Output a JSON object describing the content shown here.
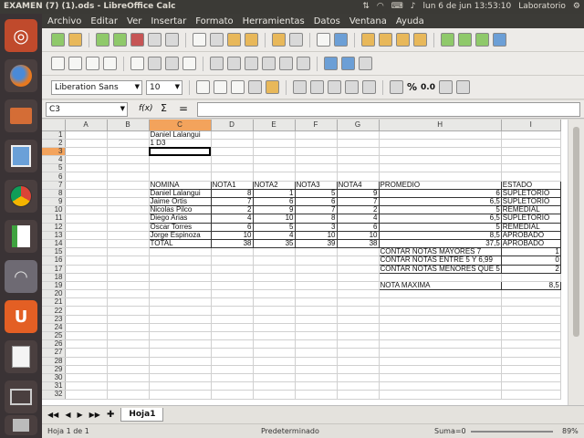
{
  "window": {
    "title": "EXAMEN (7) (1).ods - LibreOffice Calc"
  },
  "system": {
    "datetime": "lun 6 de jun 13:53:10",
    "user": "Laboratorio"
  },
  "menu": [
    "Archivo",
    "Editar",
    "Ver",
    "Insertar",
    "Formato",
    "Herramientas",
    "Datos",
    "Ventana",
    "Ayuda"
  ],
  "toolbar": {
    "font_name": "Liberation Sans",
    "font_size": "10",
    "percent": "%",
    "decimal": "0.0"
  },
  "formula": {
    "cell_ref": "C3",
    "fx": "f(x)",
    "sum": "Σ",
    "equals": "=",
    "value": ""
  },
  "columns": [
    "A",
    "B",
    "C",
    "D",
    "E",
    "F",
    "G",
    "H",
    "I"
  ],
  "selected_column": "C",
  "selected_row": 3,
  "rows": [
    {
      "n": "1",
      "c": "Daniel Lalangui"
    },
    {
      "n": "2",
      "c": "1 D3"
    },
    {
      "n": "3"
    },
    {
      "n": "4"
    },
    {
      "n": "5"
    },
    {
      "n": "6"
    },
    {
      "n": "7",
      "c": "NOMINA",
      "d": "NOTA1",
      "e": "NOTA2",
      "f": "NOTA3",
      "g": "NOTA4",
      "h": "PROMEDIO",
      "i": "ESTADO"
    },
    {
      "n": "8",
      "c": "Daniel Lalangui",
      "d": "8",
      "e": "1",
      "f": "5",
      "g": "9",
      "h": "6",
      "i": "SUPLETORIO"
    },
    {
      "n": "9",
      "c": "Jaime Ortis",
      "d": "7",
      "e": "6",
      "f": "6",
      "g": "7",
      "h": "6,5",
      "i": "SUPLETORIO"
    },
    {
      "n": "10",
      "c": "Nicolas Pilco",
      "d": "2",
      "e": "9",
      "f": "7",
      "g": "2",
      "h": "5",
      "i": "REMEDIAL"
    },
    {
      "n": "11",
      "c": "Diego Arias",
      "d": "4",
      "e": "10",
      "f": "8",
      "g": "4",
      "h": "6,5",
      "i": "SUPLETORIO"
    },
    {
      "n": "12",
      "c": "Oscar Torres",
      "d": "6",
      "e": "5",
      "f": "3",
      "g": "6",
      "h": "5",
      "i": "REMEDIAL"
    },
    {
      "n": "13",
      "c": "Jorge Espinoza",
      "d": "10",
      "e": "4",
      "f": "10",
      "g": "10",
      "h": "8,5",
      "i": "APROBADO"
    },
    {
      "n": "14",
      "c": "TOTAL",
      "d": "38",
      "e": "35",
      "f": "39",
      "g": "38",
      "h": "37,5",
      "i": "APROBADO"
    },
    {
      "n": "15",
      "h": "CONTAR NOTAS MAYORES 7",
      "i": "1"
    },
    {
      "n": "16",
      "h": "CONTAR NOTAS ENTRE 5 Y 6,99",
      "i": "0"
    },
    {
      "n": "17",
      "h": "CONTAR NOTAS MENORES QUE 5",
      "i": "2"
    },
    {
      "n": "18"
    },
    {
      "n": "19",
      "h": "NOTA MAXIMA",
      "i": "8,5"
    },
    {
      "n": "20"
    },
    {
      "n": "21"
    },
    {
      "n": "22"
    },
    {
      "n": "23"
    },
    {
      "n": "24"
    },
    {
      "n": "25"
    },
    {
      "n": "26"
    },
    {
      "n": "27"
    },
    {
      "n": "28"
    },
    {
      "n": "29"
    },
    {
      "n": "30"
    },
    {
      "n": "31"
    },
    {
      "n": "32"
    }
  ],
  "sheet": {
    "tab": "Hoja1"
  },
  "status": {
    "sheet": "Hoja 1 de 1",
    "style": "Predeterminado",
    "sum": "Suma=0",
    "zoom": "89%"
  }
}
